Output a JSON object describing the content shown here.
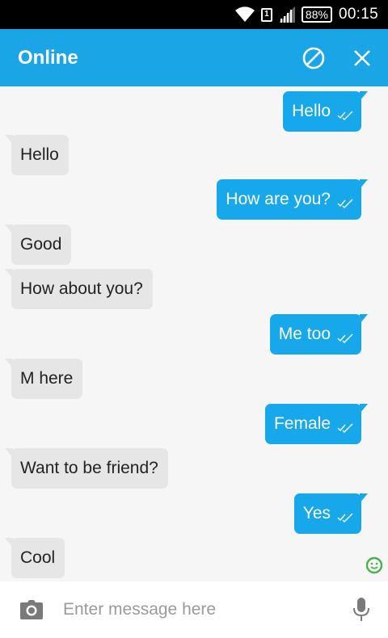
{
  "status_bar": {
    "sim_label": "1",
    "battery": "88%",
    "time": "00:15",
    "icons": [
      "wifi-icon",
      "sim-icon",
      "signal-icon",
      "battery-icon"
    ]
  },
  "header": {
    "title": "Online",
    "icons": [
      "block-icon",
      "close-icon"
    ],
    "background": "#1aa6e6"
  },
  "messages": [
    {
      "direction": "out",
      "text": "Hello",
      "status": "double-check-icon"
    },
    {
      "direction": "in",
      "text": "Hello"
    },
    {
      "direction": "out",
      "text": "How are you?",
      "status": "double-check-icon"
    },
    {
      "direction": "in",
      "text": "Good"
    },
    {
      "direction": "in",
      "text": "How about you?"
    },
    {
      "direction": "out",
      "text": "Me too",
      "status": "double-check-icon"
    },
    {
      "direction": "in",
      "text": "M here"
    },
    {
      "direction": "out",
      "text": "Female",
      "status": "double-check-icon"
    },
    {
      "direction": "in",
      "text": "Want to be friend?"
    },
    {
      "direction": "out",
      "text": "Yes",
      "status": "double-check-icon"
    },
    {
      "direction": "in",
      "text": "Cool"
    }
  ],
  "colors": {
    "outgoing_bubble": "#16a8ea",
    "incoming_bubble": "#e6e6e6",
    "online_indicator": "#4caf50"
  },
  "composer": {
    "placeholder": "Enter message here",
    "value": "",
    "icons": [
      "camera-icon",
      "microphone-icon"
    ]
  }
}
